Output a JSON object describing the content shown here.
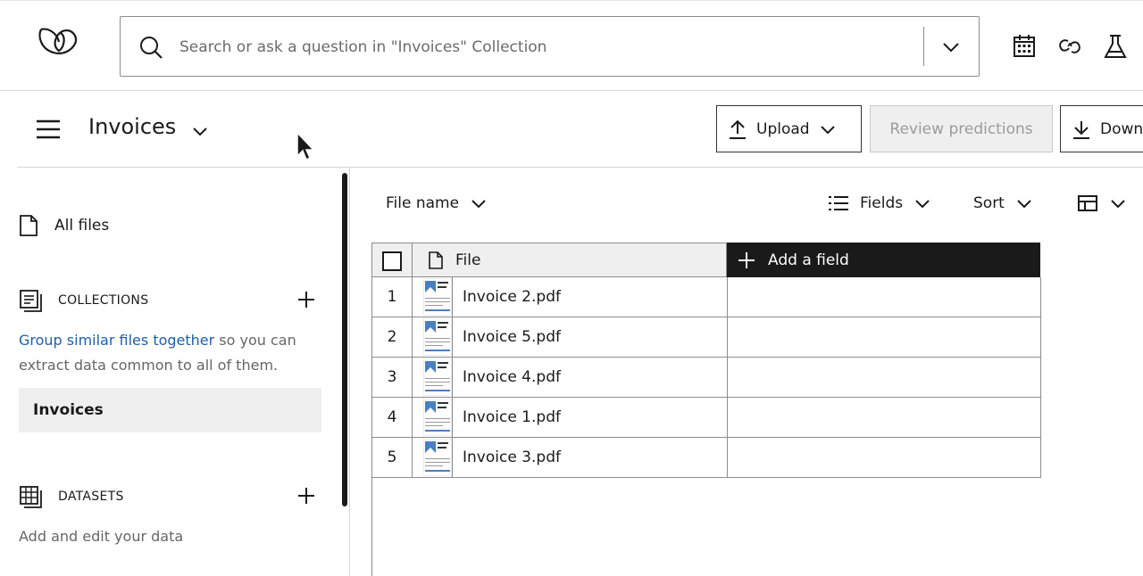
{
  "header": {
    "search_placeholder": "Search or ask a question in \"Invoices\" Collection",
    "icons": [
      "calendar-icon",
      "ai-link-icon",
      "flask-icon"
    ]
  },
  "subheader": {
    "title": "Invoices",
    "upload_label": "Upload",
    "review_label": "Review predictions",
    "download_label": "Down"
  },
  "sidebar": {
    "all_files_label": "All files",
    "collections_label": "COLLECTIONS",
    "collections_link": "Group similar files together",
    "collections_text": " so you can extract data common to all of them.",
    "selected_collection": "Invoices",
    "datasets_label": "DATASETS",
    "datasets_text": "Add and edit your data"
  },
  "toolbar": {
    "file_name_label": "File name",
    "fields_label": "Fields",
    "sort_label": "Sort"
  },
  "table": {
    "file_header": "File",
    "add_field_label": "Add a field",
    "rows": [
      {
        "num": "1",
        "name": "Invoice 2.pdf"
      },
      {
        "num": "2",
        "name": "Invoice 5.pdf"
      },
      {
        "num": "3",
        "name": "Invoice 4.pdf"
      },
      {
        "num": "4",
        "name": "Invoice 1.pdf"
      },
      {
        "num": "5",
        "name": "Invoice 3.pdf"
      }
    ]
  },
  "colors": {
    "accent_link": "#1f5ea8",
    "header_dark": "#1a1a1a",
    "thumb_blue": "#4a7fc1"
  }
}
